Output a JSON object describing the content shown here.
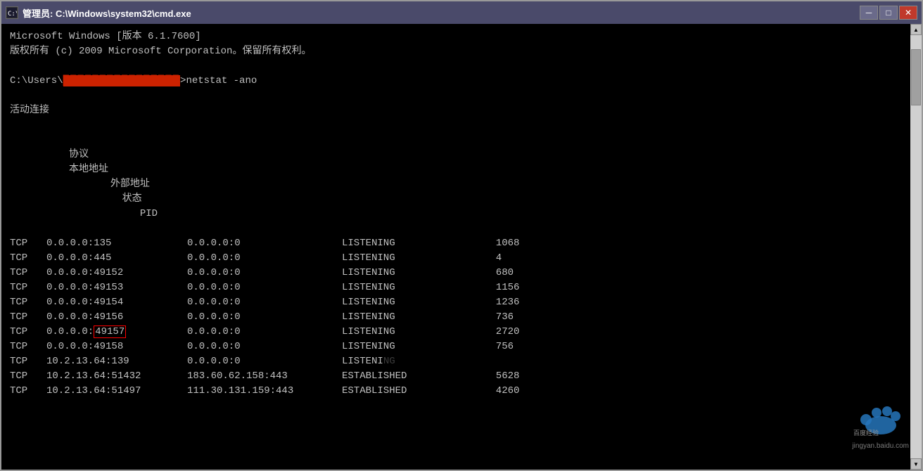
{
  "window": {
    "title": "管理员: C:\\Windows\\system32\\cmd.exe",
    "icon_label": "C:\\",
    "btn_minimize": "─",
    "btn_maximize": "□",
    "btn_close": "✕"
  },
  "terminal": {
    "line1": "Microsoft Windows [版本 6.1.7600]",
    "line2": "版权所有 (c) 2009 Microsoft Corporation。保留所有权利。",
    "line3_prefix": "C:\\Users\\",
    "line3_redacted": "████████████████",
    "line3_suffix": ">netstat -ano",
    "line4": "",
    "line5": "活动连接",
    "line6": "",
    "header_proto": "协议",
    "header_local": "本地地址",
    "header_foreign": "外部地址",
    "header_state": "状态",
    "header_pid": "PID"
  },
  "connections": [
    {
      "proto": "TCP",
      "local": "0.0.0.0:135",
      "foreign": "0.0.0.0:0",
      "state": "LISTENING",
      "pid": "1068",
      "highlight": false
    },
    {
      "proto": "TCP",
      "local": "0.0.0.0:445",
      "foreign": "0.0.0.0:0",
      "state": "LISTENING",
      "pid": "4",
      "highlight": false
    },
    {
      "proto": "TCP",
      "local": "0.0.0.0:49152",
      "foreign": "0.0.0.0:0",
      "state": "LISTENING",
      "pid": "680",
      "highlight": false
    },
    {
      "proto": "TCP",
      "local": "0.0.0.0:49153",
      "foreign": "0.0.0.0:0",
      "state": "LISTENING",
      "pid": "1156",
      "highlight": false
    },
    {
      "proto": "TCP",
      "local": "0.0.0.0:49154",
      "foreign": "0.0.0.0:0",
      "state": "LISTENING",
      "pid": "1236",
      "highlight": false
    },
    {
      "proto": "TCP",
      "local": "0.0.0.0:49156",
      "foreign": "0.0.0.0:0",
      "state": "LISTENING",
      "pid": "736",
      "highlight": false
    },
    {
      "proto": "TCP",
      "local": "0.0.0.0:49157",
      "foreign": "0.0.0.0:0",
      "state": "LISTENING",
      "pid": "2720",
      "highlight": true
    },
    {
      "proto": "TCP",
      "local": "0.0.0.0:49158",
      "foreign": "0.0.0.0:0",
      "state": "LISTENING",
      "pid": "756",
      "highlight": false
    },
    {
      "proto": "TCP",
      "local": "10.2.13.64:139",
      "foreign": "0.0.0.0:0",
      "state": "LISTENING",
      "pid": "",
      "highlight": false
    },
    {
      "proto": "TCP",
      "local": "10.2.13.64:51432",
      "foreign": "183.60.62.158:443",
      "state": "ESTABLISHED",
      "pid": "5628",
      "highlight": false
    },
    {
      "proto": "TCP",
      "local": "10.2.13.64:51497",
      "foreign": "111.30.131.159:443",
      "state": "ESTABLISHED",
      "pid": "4260",
      "highlight": false
    }
  ],
  "watermark": {
    "site": "jingyan.baidu.com"
  }
}
